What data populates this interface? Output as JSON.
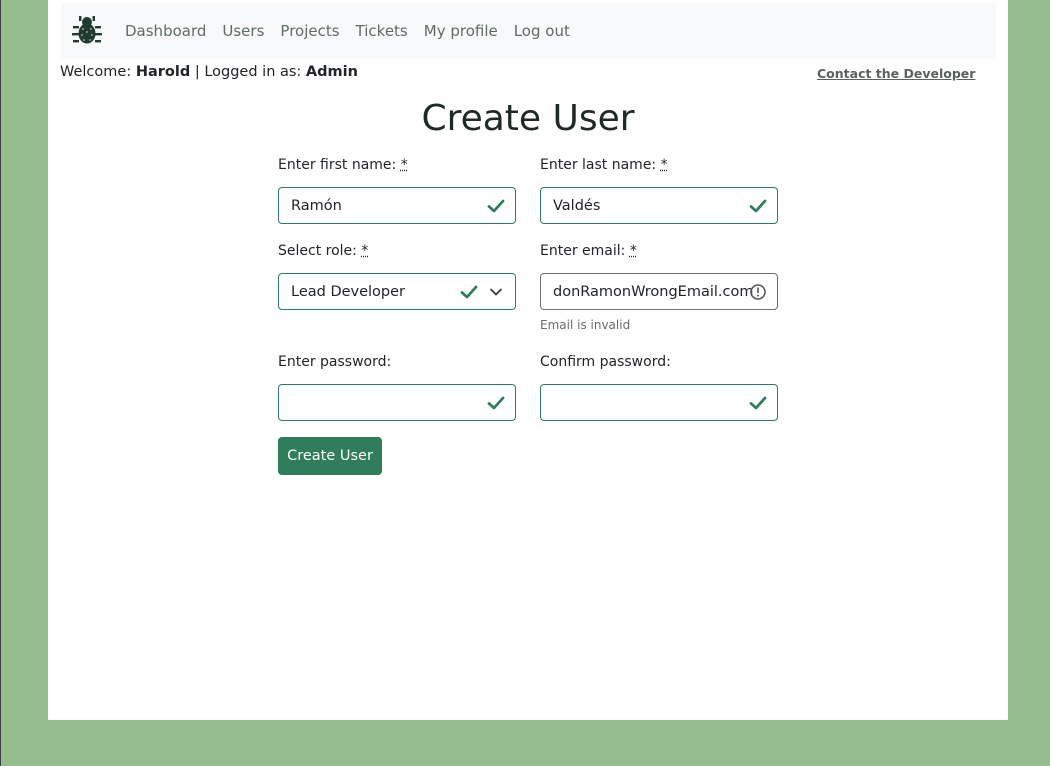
{
  "nav": {
    "items": [
      {
        "label": "Dashboard"
      },
      {
        "label": "Users"
      },
      {
        "label": "Projects"
      },
      {
        "label": "Tickets"
      },
      {
        "label": "My profile"
      },
      {
        "label": "Log out"
      }
    ]
  },
  "welcome": {
    "prefix": "Welcome:",
    "user": "Harold",
    "separator": "| Logged in as:",
    "role": "Admin"
  },
  "contact_link": "Contact the Developer",
  "page_title": "Create User",
  "form": {
    "first_name": {
      "label": "Enter first name:",
      "required_mark": "*",
      "value": "Ramón"
    },
    "last_name": {
      "label": "Enter last name:",
      "required_mark": "*",
      "value": "Valdés"
    },
    "role": {
      "label": "Select role:",
      "required_mark": "*",
      "value": "Lead Developer"
    },
    "email": {
      "label": "Enter email:",
      "required_mark": "*",
      "value": "donRamonWrongEmail.com",
      "error": "Email is invalid"
    },
    "password": {
      "label": "Enter password:",
      "value": ""
    },
    "confirm_password": {
      "label": "Confirm password:",
      "value": ""
    },
    "submit_label": "Create User"
  },
  "colors": {
    "background": "#93bd8c",
    "accent": "#2f7d5a",
    "navbar": "#f7f9fa"
  },
  "icons": {
    "brand": "bug-icon",
    "valid": "check-icon",
    "invalid": "exclamation-circle-icon",
    "dropdown": "chevron-down-icon"
  }
}
